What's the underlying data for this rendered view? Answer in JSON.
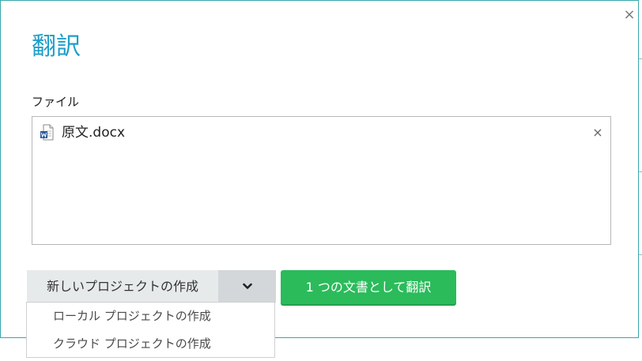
{
  "dialog": {
    "title": "翻訳",
    "close_glyph": "×"
  },
  "files": {
    "label": "ファイル",
    "items": [
      {
        "name": "原文.docx",
        "icon": "word-document-icon",
        "remove_glyph": "×"
      }
    ]
  },
  "project_button": {
    "label": "新しいプロジェクトの作成",
    "toggle_icon": "chevron-down-icon",
    "menu": [
      {
        "label": "ローカル プロジェクトの作成"
      },
      {
        "label": "クラウド プロジェクトの作成"
      }
    ]
  },
  "translate_button": {
    "label": "1 つの文書として翻訳"
  },
  "colors": {
    "title": "#1f9ec9",
    "translate_bg": "#2bbb5b",
    "dialog_border": "#39a7ad",
    "word_blue": "#2b579a"
  }
}
